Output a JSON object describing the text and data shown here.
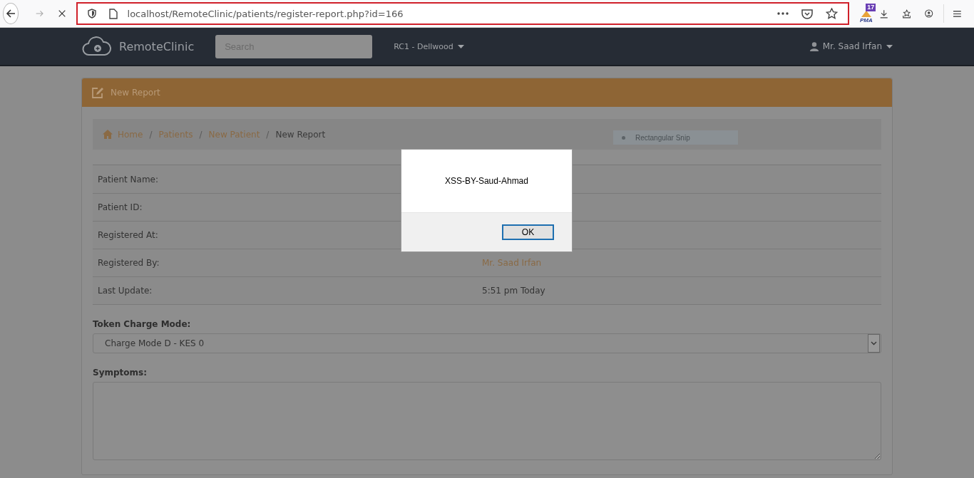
{
  "browser": {
    "url": "localhost/RemoteClinic/patients/register-report.php?id=166",
    "url_highlighted": true,
    "extension_badge": "17",
    "extension_label": "PMA"
  },
  "navbar": {
    "brand": "RemoteClinic",
    "search": {
      "placeholder": "Search"
    },
    "clinic_menu": "RC1 - Dellwood",
    "user_menu": "Mr. Saad Irfan"
  },
  "panel": {
    "title": "New Report",
    "breadcrumb_separator": "/",
    "breadcrumb": [
      {
        "label": "Home",
        "kind": "link"
      },
      {
        "label": "Patients",
        "kind": "link"
      },
      {
        "label": "New Patient",
        "kind": "link"
      },
      {
        "label": "New Report",
        "kind": "current"
      }
    ],
    "snip_tooltip": "Rectangular Snip",
    "details": [
      {
        "label": "Patient Name:"
      },
      {
        "label": "Patient ID:"
      },
      {
        "label": "Registered At:"
      },
      {
        "label": "Registered By:",
        "value": "Mr. Saad Irfan",
        "kind": "link"
      },
      {
        "label": "Last Update:",
        "value": "5:51 pm Today",
        "kind": "text"
      }
    ],
    "token_charge_mode": {
      "label": "Token Charge Mode:",
      "value": "Charge Mode D - KES 0"
    },
    "symptoms": {
      "label": "Symptoms:"
    }
  },
  "alert": {
    "message": "XSS-BY-Saud-Ahmad",
    "button": "OK"
  }
}
